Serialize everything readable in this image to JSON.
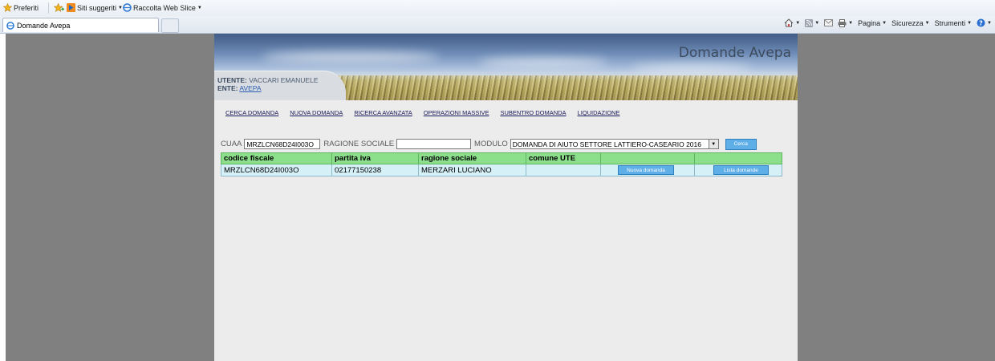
{
  "browser": {
    "favorites_bar": {
      "favorites_label": "Preferiti",
      "suggested_label": "Siti suggeriti",
      "webslice_label": "Raccolta Web Slice"
    },
    "tab_title": "Domande Avepa",
    "command_bar": {
      "page_label": "Pagina",
      "security_label": "Sicurezza",
      "tools_label": "Strumenti"
    }
  },
  "page": {
    "banner_title": "Domande Avepa",
    "user": {
      "label": "UTENTE:",
      "name": "VACCARI EMANUELE"
    },
    "ente": {
      "label": "ENTE:",
      "value": "AVEPA"
    },
    "nav": [
      "CERCA DOMANDA",
      "NUOVA DOMANDA",
      "RICERCA AVANZATA",
      "OPERAZIONI MASSIVE",
      "SUBENTRO DOMANDA",
      "LIQUIDAZIONE"
    ],
    "search": {
      "cuaa_label": "CUAA",
      "cuaa_value": "MRZLCN68D24I003O",
      "ragione_label": "RAGIONE SOCIALE",
      "ragione_value": "",
      "modulo_label": "MODULO",
      "modulo_value": "DOMANDA DI AIUTO SETTORE LATTIERO-CASEARIO 2016",
      "cerca_label": "Cerca"
    },
    "results": {
      "headers": [
        "codice fiscale",
        "partita iva",
        "ragione sociale",
        "comune UTE",
        "",
        ""
      ],
      "rows": [
        {
          "codice_fiscale": "MRZLCN68D24I003O",
          "partita_iva": "02177150238",
          "ragione_sociale": "MERZARI LUCIANO",
          "comune_ute": "",
          "nuova_label": "Nuova domanda",
          "lista_label": "Lista domande"
        }
      ]
    }
  },
  "colors": {
    "header_row": "#8ce08c",
    "data_row": "#d6f0f8",
    "button": "#5eaee8",
    "page_bg": "#ececec",
    "outer_bg": "#808080"
  }
}
